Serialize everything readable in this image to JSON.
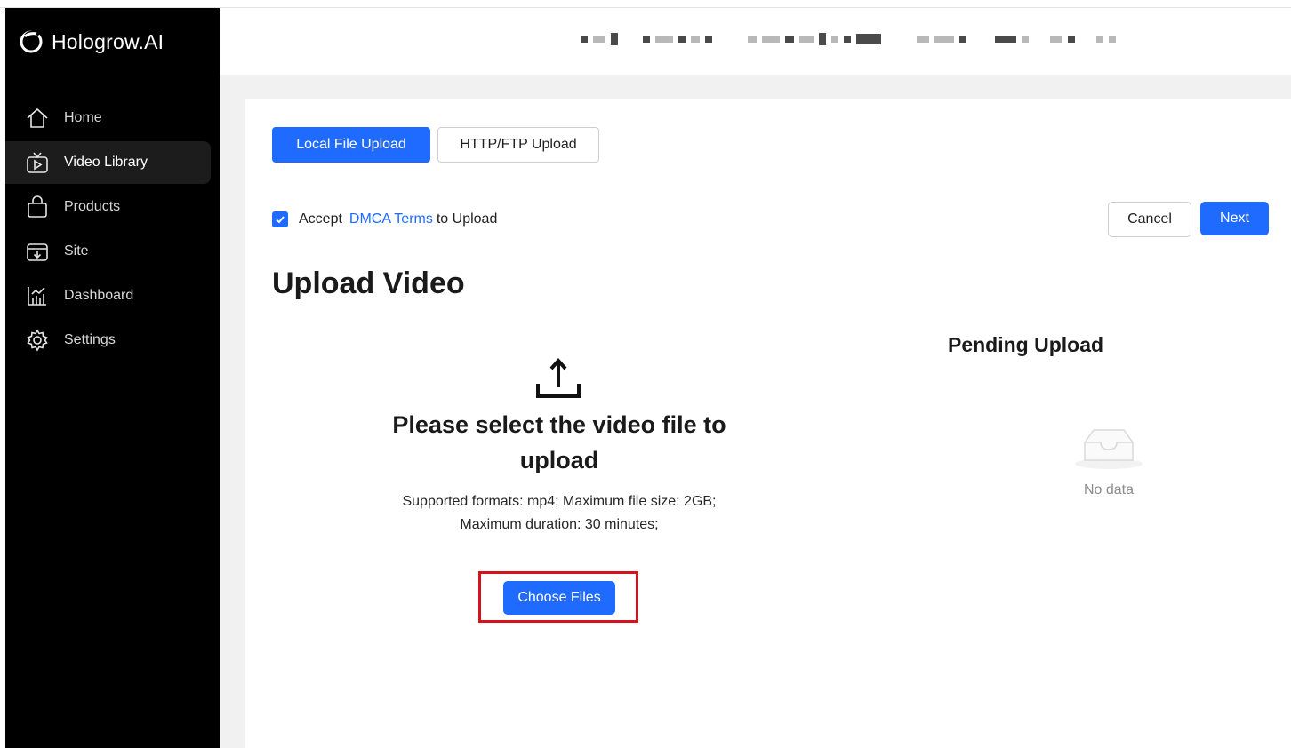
{
  "brand": {
    "name": "Hologrow.AI",
    "logo_icon": "hologrow-logo-icon"
  },
  "sidebar": {
    "items": [
      {
        "label": "Home",
        "icon": "home-icon",
        "active": false
      },
      {
        "label": "Video Library",
        "icon": "video-library-icon",
        "active": true
      },
      {
        "label": "Products",
        "icon": "shopping-bag-icon",
        "active": false
      },
      {
        "label": "Site",
        "icon": "site-download-icon",
        "active": false
      },
      {
        "label": "Dashboard",
        "icon": "chart-icon",
        "active": false
      },
      {
        "label": "Settings",
        "icon": "gear-icon",
        "active": false
      }
    ]
  },
  "tabs": {
    "local": "Local File Upload",
    "http": "HTTP/FTP Upload"
  },
  "accept": {
    "prefix": "Accept",
    "link": "DMCA Terms",
    "suffix": "to Upload",
    "checked": true
  },
  "actions": {
    "cancel": "Cancel",
    "next": "Next"
  },
  "page_title": "Upload Video",
  "upload": {
    "heading": "Please select the video file to upload",
    "desc_line1": "Supported formats: mp4; Maximum file size: 2GB;",
    "desc_line2": "Maximum duration: 30 minutes;",
    "choose_button": "Choose Files"
  },
  "pending": {
    "title": "Pending Upload",
    "empty_text": "No data"
  },
  "colors": {
    "primary": "#1f6bff",
    "sidebar_bg": "#000000",
    "highlight": "#d3141e"
  }
}
